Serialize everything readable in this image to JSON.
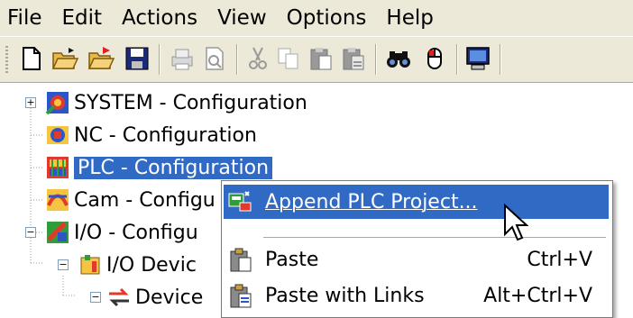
{
  "menubar": {
    "items": [
      {
        "label": "File"
      },
      {
        "label": "Edit"
      },
      {
        "label": "Actions"
      },
      {
        "label": "View"
      },
      {
        "label": "Options"
      },
      {
        "label": "Help"
      }
    ]
  },
  "toolbar": {
    "icons": [
      "new-icon",
      "open-icon",
      "open-from-target-icon",
      "save-icon",
      "print-icon",
      "print-preview-icon",
      "cut-icon",
      "copy-icon",
      "paste-icon",
      "paste-with-links-icon",
      "find-icon",
      "mouse-icon",
      "monitor-icon"
    ]
  },
  "tree": {
    "nodes": [
      {
        "label": "SYSTEM - Configuration",
        "expander": "+"
      },
      {
        "label": "NC - Configuration"
      },
      {
        "label": "PLC - Configuration"
      },
      {
        "label": "Cam - Configu"
      },
      {
        "label": "I/O - Configu",
        "expander": "−"
      },
      {
        "label": "I/O Devic",
        "expander": "−"
      },
      {
        "label": "Device",
        "expander": "−"
      }
    ]
  },
  "context_menu": {
    "items": [
      {
        "label": "Append PLC Project...",
        "shortcut": ""
      },
      {
        "label": "Paste",
        "shortcut": "Ctrl+V"
      },
      {
        "label": "Paste with Links",
        "shortcut": "Alt+Ctrl+V"
      }
    ]
  },
  "colors": {
    "selection": "#316ac5",
    "chrome": "#ece9d8"
  }
}
